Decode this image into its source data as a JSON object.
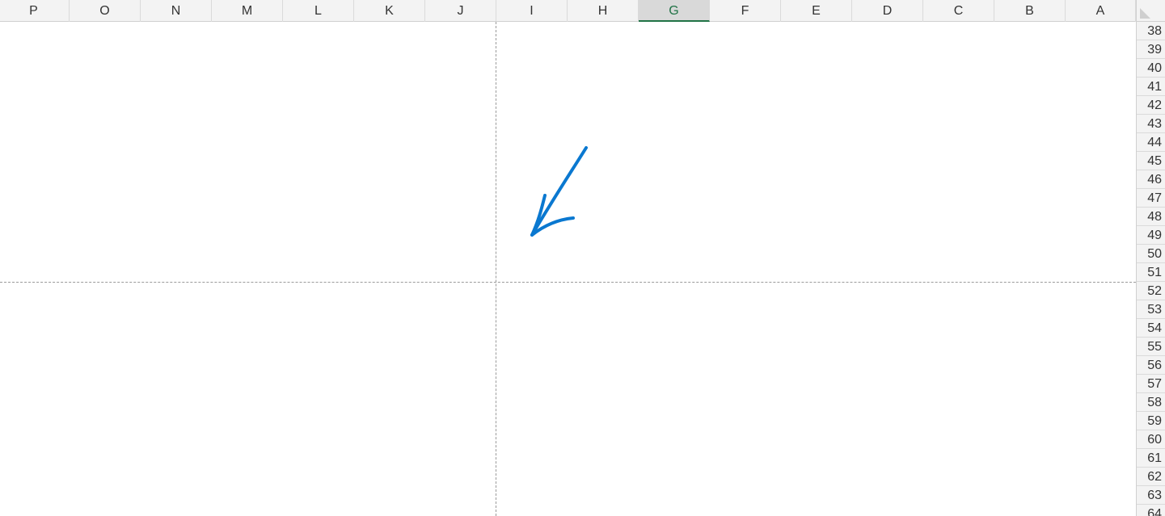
{
  "columns": [
    "P",
    "O",
    "N",
    "M",
    "L",
    "K",
    "J",
    "I",
    "H",
    "G",
    "F",
    "E",
    "D",
    "C",
    "B",
    "A"
  ],
  "selected_column": "G",
  "rows": [
    "38",
    "39",
    "40",
    "41",
    "42",
    "43",
    "44",
    "45",
    "46",
    "47",
    "48",
    "49",
    "50",
    "51",
    "52",
    "53",
    "54",
    "55",
    "56",
    "57",
    "58",
    "59",
    "60",
    "61",
    "62",
    "63",
    "64"
  ],
  "colors": {
    "ink": "#0a78d0",
    "accent": "#217346",
    "header_bg": "#f3f3f3"
  },
  "drawing": {
    "icon": "ink-arrow-icon"
  }
}
